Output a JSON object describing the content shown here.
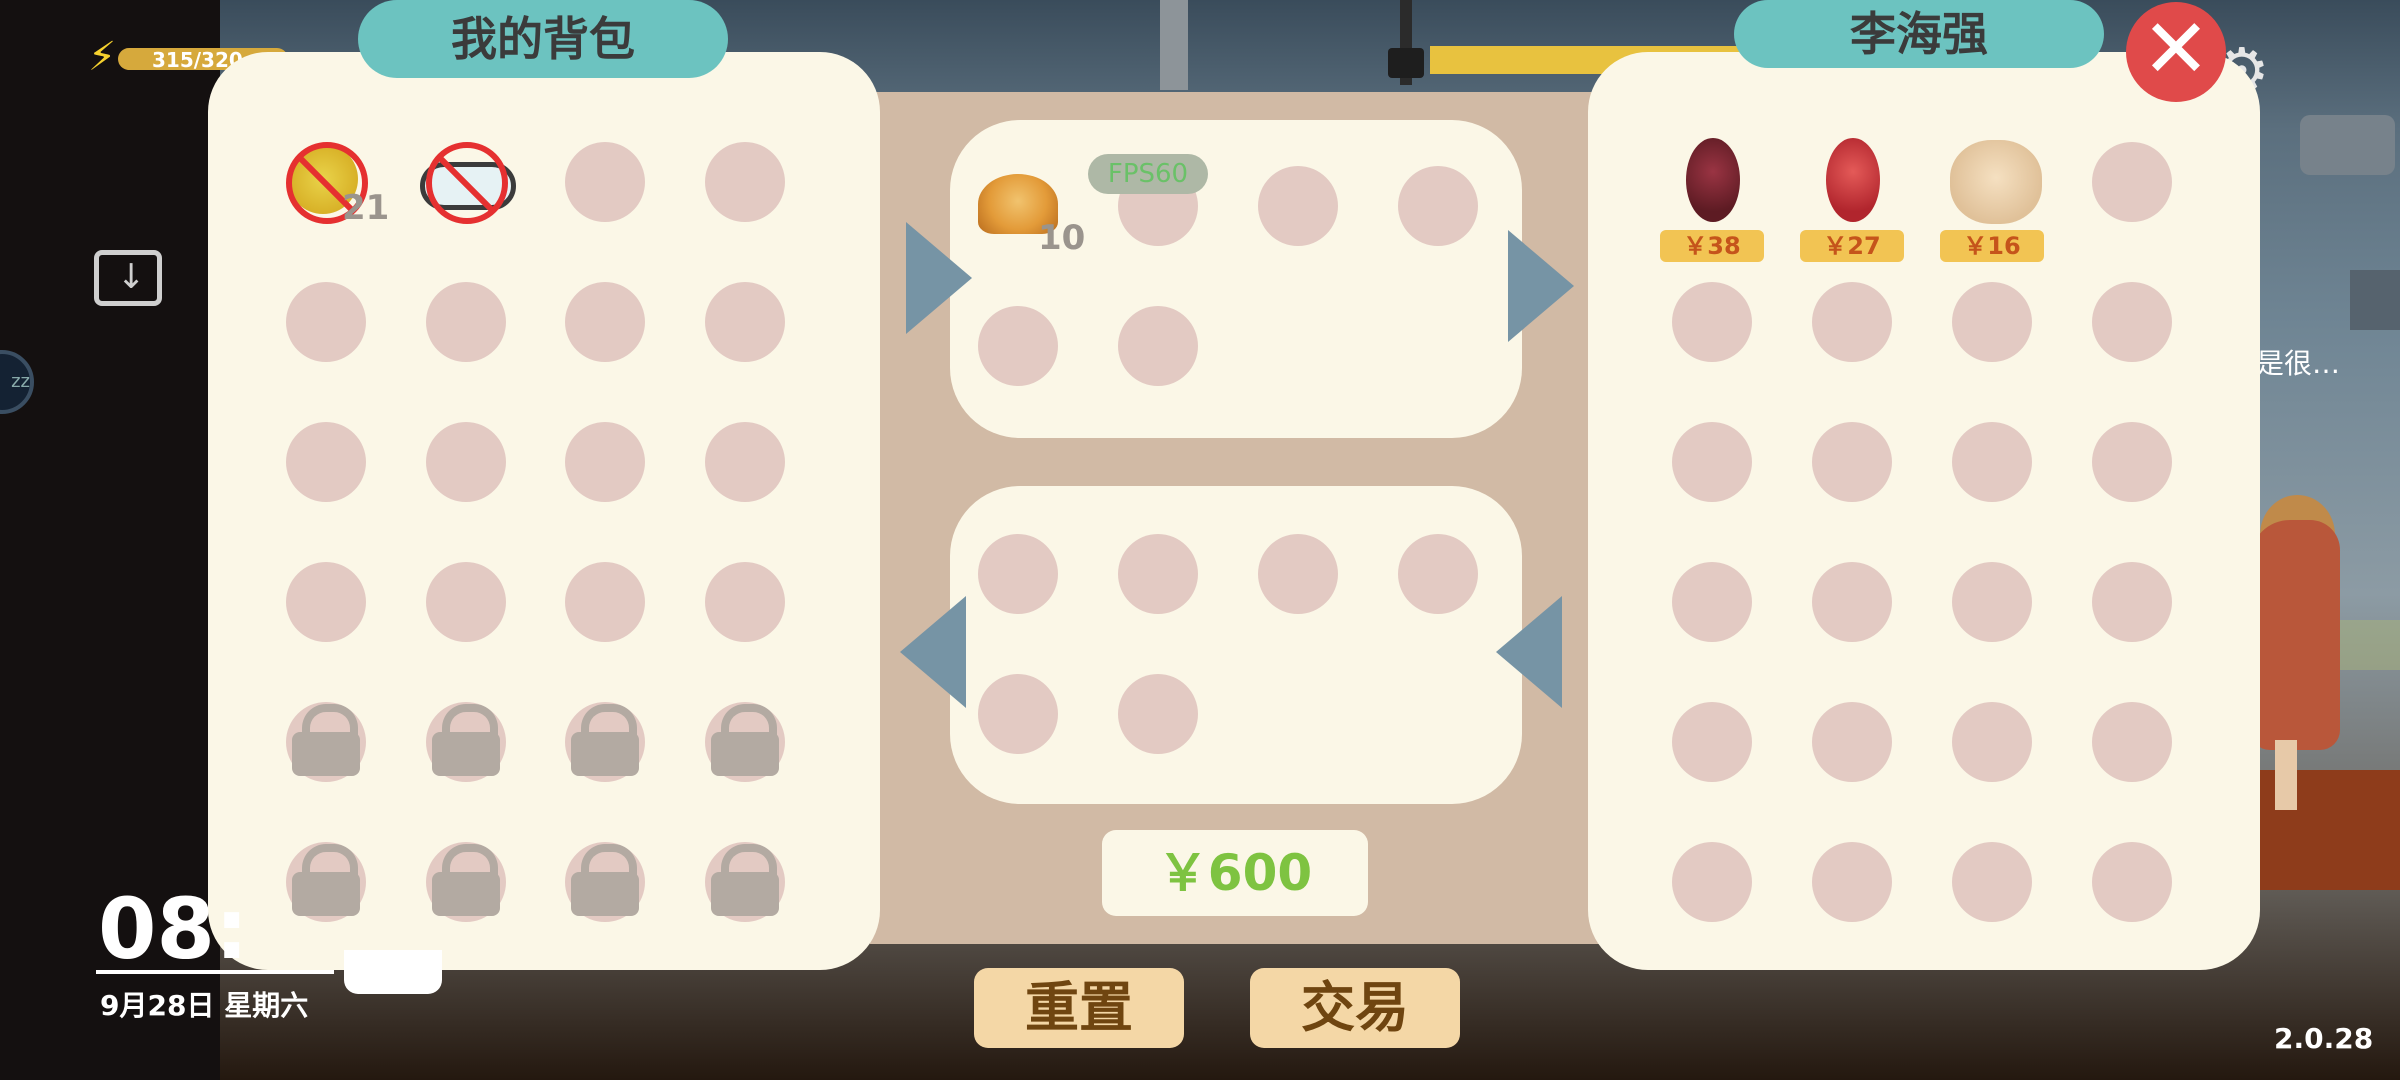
{
  "hud": {
    "energy_text": "315/320",
    "clock_time": "08:",
    "clock_date": "9月28日 星期六",
    "version": "2.0.28",
    "hint_text": "是很…"
  },
  "inventory": {
    "title": "我的背包",
    "items": [
      {
        "name": "coin-item",
        "qty": "21"
      },
      {
        "name": "plate-item",
        "qty": ""
      }
    ]
  },
  "trade": {
    "offer_item_qty": "10",
    "fps_label": "FPS60",
    "total_price": "￥600",
    "reset_label": "重置",
    "trade_label": "交易"
  },
  "merchant": {
    "name": "李海强",
    "items": [
      {
        "name": "liver-item",
        "price": "￥38"
      },
      {
        "name": "red-meat-item",
        "price": "￥27"
      },
      {
        "name": "roast-chicken-item",
        "price": "￥16"
      }
    ]
  }
}
